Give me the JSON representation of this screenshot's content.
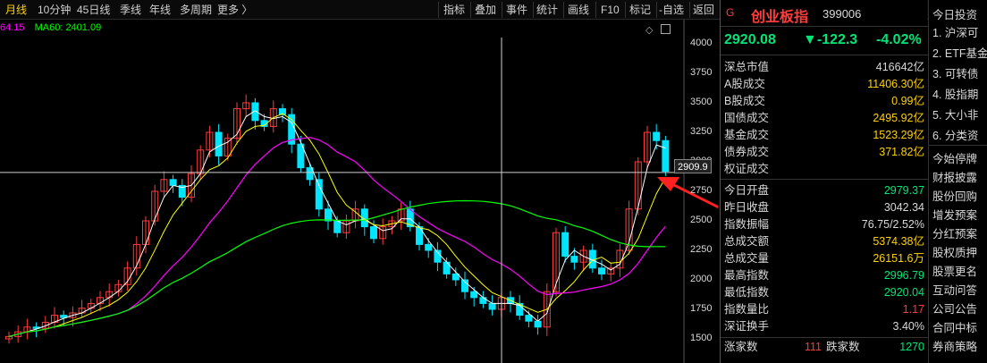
{
  "toolbar": {
    "left_items": [
      "月线",
      "10分钟",
      "45日线",
      "季线",
      "年线",
      "多周期",
      "更多 〉"
    ],
    "right_items": [
      "指标",
      "叠加",
      "事件",
      "统计",
      "画线",
      "F10",
      "标记",
      "-自选",
      "返回"
    ],
    "active": "月线"
  },
  "legend": {
    "ma_partial": "64.15",
    "ma60": "MA60: 2401.09"
  },
  "axis": {
    "ticks": [
      "4000",
      "3750",
      "3500",
      "3250",
      "3000",
      "2750",
      "2500",
      "2250",
      "2000",
      "1750",
      "1500"
    ],
    "cursor_value": "2909.9",
    "icons": [
      "diamond-icon",
      "window-icon"
    ]
  },
  "quote": {
    "flag": "G",
    "name": "创业板指",
    "code": "399006",
    "price": "2920.08",
    "change": "▼-122.3",
    "change_pct": "-4.02%",
    "rows_top": [
      {
        "label": "深总市值",
        "value": "416642亿",
        "color": "#d8d8d8"
      },
      {
        "label": "A股成交",
        "value": "11406.30亿",
        "color": "#ffd200"
      },
      {
        "label": "B股成交",
        "value": "0.99亿",
        "color": "#ffd200"
      },
      {
        "label": "国债成交",
        "value": "2495.92亿",
        "color": "#ffd200"
      },
      {
        "label": "基金成交",
        "value": "1523.29亿",
        "color": "#ffd200"
      },
      {
        "label": "债券成交",
        "value": "371.82亿",
        "color": "#ffd200"
      },
      {
        "label": "权证成交",
        "value": "",
        "color": "#ffd200"
      }
    ],
    "rows_bottom": [
      {
        "label": "今日开盘",
        "value": "2979.37",
        "color": "#00e676"
      },
      {
        "label": "昨日收盘",
        "value": "3042.34",
        "color": "#d8d8d8"
      },
      {
        "label": "指数振幅",
        "value": "76.75/2.52%",
        "color": "#d8d8d8"
      },
      {
        "label": "总成交额",
        "value": "5374.38亿",
        "color": "#ffd200"
      },
      {
        "label": "总成交量",
        "value": "26151.6万",
        "color": "#ffd200"
      },
      {
        "label": "最高指数",
        "value": "2996.79",
        "color": "#00e676"
      },
      {
        "label": "最低指数",
        "value": "2920.04",
        "color": "#00e676"
      },
      {
        "label": "指数量比",
        "value": "1.17",
        "color": "#ff3c3c"
      },
      {
        "label": "深证换手",
        "value": "3.40%",
        "color": "#d8d8d8"
      }
    ],
    "rise_label": "涨家数",
    "rise_value": "111",
    "fall_label": "跌家数",
    "fall_value": "1270"
  },
  "side": {
    "header": "今日投资",
    "items": [
      "1. 沪深可",
      "2. ETF基金",
      "3. 可转债",
      "4. 股指期",
      "5. 大小非",
      "6. 分类资"
    ],
    "links": [
      "今始停牌",
      "财报披露",
      "股份回购",
      "增发预案",
      "分红预案",
      "股权质押",
      "股票更名",
      "互动问答",
      "公司公告",
      "合同中标",
      "券商策略"
    ]
  },
  "colors": {
    "up": "#ff3c3c",
    "down": "#00e5ff",
    "ma5": "#ffffff",
    "ma10": "#ffff00",
    "ma20": "#ff00ff",
    "ma60": "#00ff00",
    "arrow": "#ff2020"
  }
}
